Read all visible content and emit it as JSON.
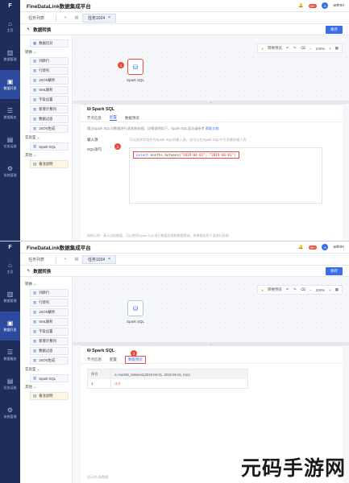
{
  "app": {
    "title": "FineDataLink数据集成平台",
    "logo": "F",
    "notification_count": "99+",
    "user": "admin"
  },
  "nav": [
    {
      "icon": "home-icon",
      "glyph": "⌂",
      "label": "主页"
    },
    {
      "icon": "chart-icon",
      "glyph": "▥",
      "label": "数据管理"
    },
    {
      "icon": "dev-icon",
      "glyph": "▣",
      "label": "数据开发"
    },
    {
      "icon": "service-icon",
      "glyph": "☰",
      "label": "数据服务"
    },
    {
      "icon": "task-icon",
      "glyph": "▤",
      "label": "任务运维"
    },
    {
      "icon": "settings-icon",
      "glyph": "⚙",
      "label": "系统管理"
    }
  ],
  "tabs": {
    "list": "任务列表",
    "add": "+",
    "active": "任务1024",
    "close": "×"
  },
  "subheader": {
    "back": "↰",
    "title": "数据转换",
    "save": "保存"
  },
  "palette": {
    "top_item": "数据比对",
    "group1": "转换",
    "items1": [
      "列转行",
      "行转列",
      "JSON解析",
      "XML解析",
      "字段设置",
      "新增计算列",
      "数据过滤",
      "JSON生成"
    ],
    "group2": "实验室",
    "items2": [
      "Spark SQL"
    ],
    "group3": "其他",
    "items3": [
      "备注说明"
    ]
  },
  "toolbar": {
    "run": "转换预览",
    "undo": "↶",
    "redo": "↷",
    "zoom_out": "−",
    "zoom": "100%",
    "zoom_in": "+"
  },
  "node": {
    "label": "Spark SQL",
    "callout": "1"
  },
  "panel": {
    "title": "Spark SQL",
    "tab_node": "节点信息",
    "tab_config": "配置",
    "tab_preview": "数据预览",
    "hint": "通过Spark SQL对数据进行清洗和处理，详情说明如下。Spark SQL语法请参考",
    "hint_link": "帮助文档",
    "input_label": "输入源",
    "input_hint": "可以选择字段作为Spark SQL的输入源，也可以在Spark SQL中引用最终输入表",
    "sql_label": "SQL语句",
    "sql_callout": "2",
    "sql_kw": "select",
    "sql_fn": "months_between(",
    "sql_arg1": "\"2019-04-01\"",
    "sql_comma": ", ",
    "sql_arg2": "\"2019-06-01\"",
    "sql_end": ")",
    "footer": "说明示例：表示当前数据。可以使用Spark SQL进行数据处理和数据筛选，结果输出到下游进行处理"
  },
  "preview": {
    "callout": "3",
    "columns": [
      "序号",
      "months_between(2019-04-01, 2019-06-01, true)"
    ],
    "rows": [
      [
        "1",
        "-2.0"
      ]
    ],
    "footer": "显示前1条数据"
  },
  "watermark": "元码手游网"
}
